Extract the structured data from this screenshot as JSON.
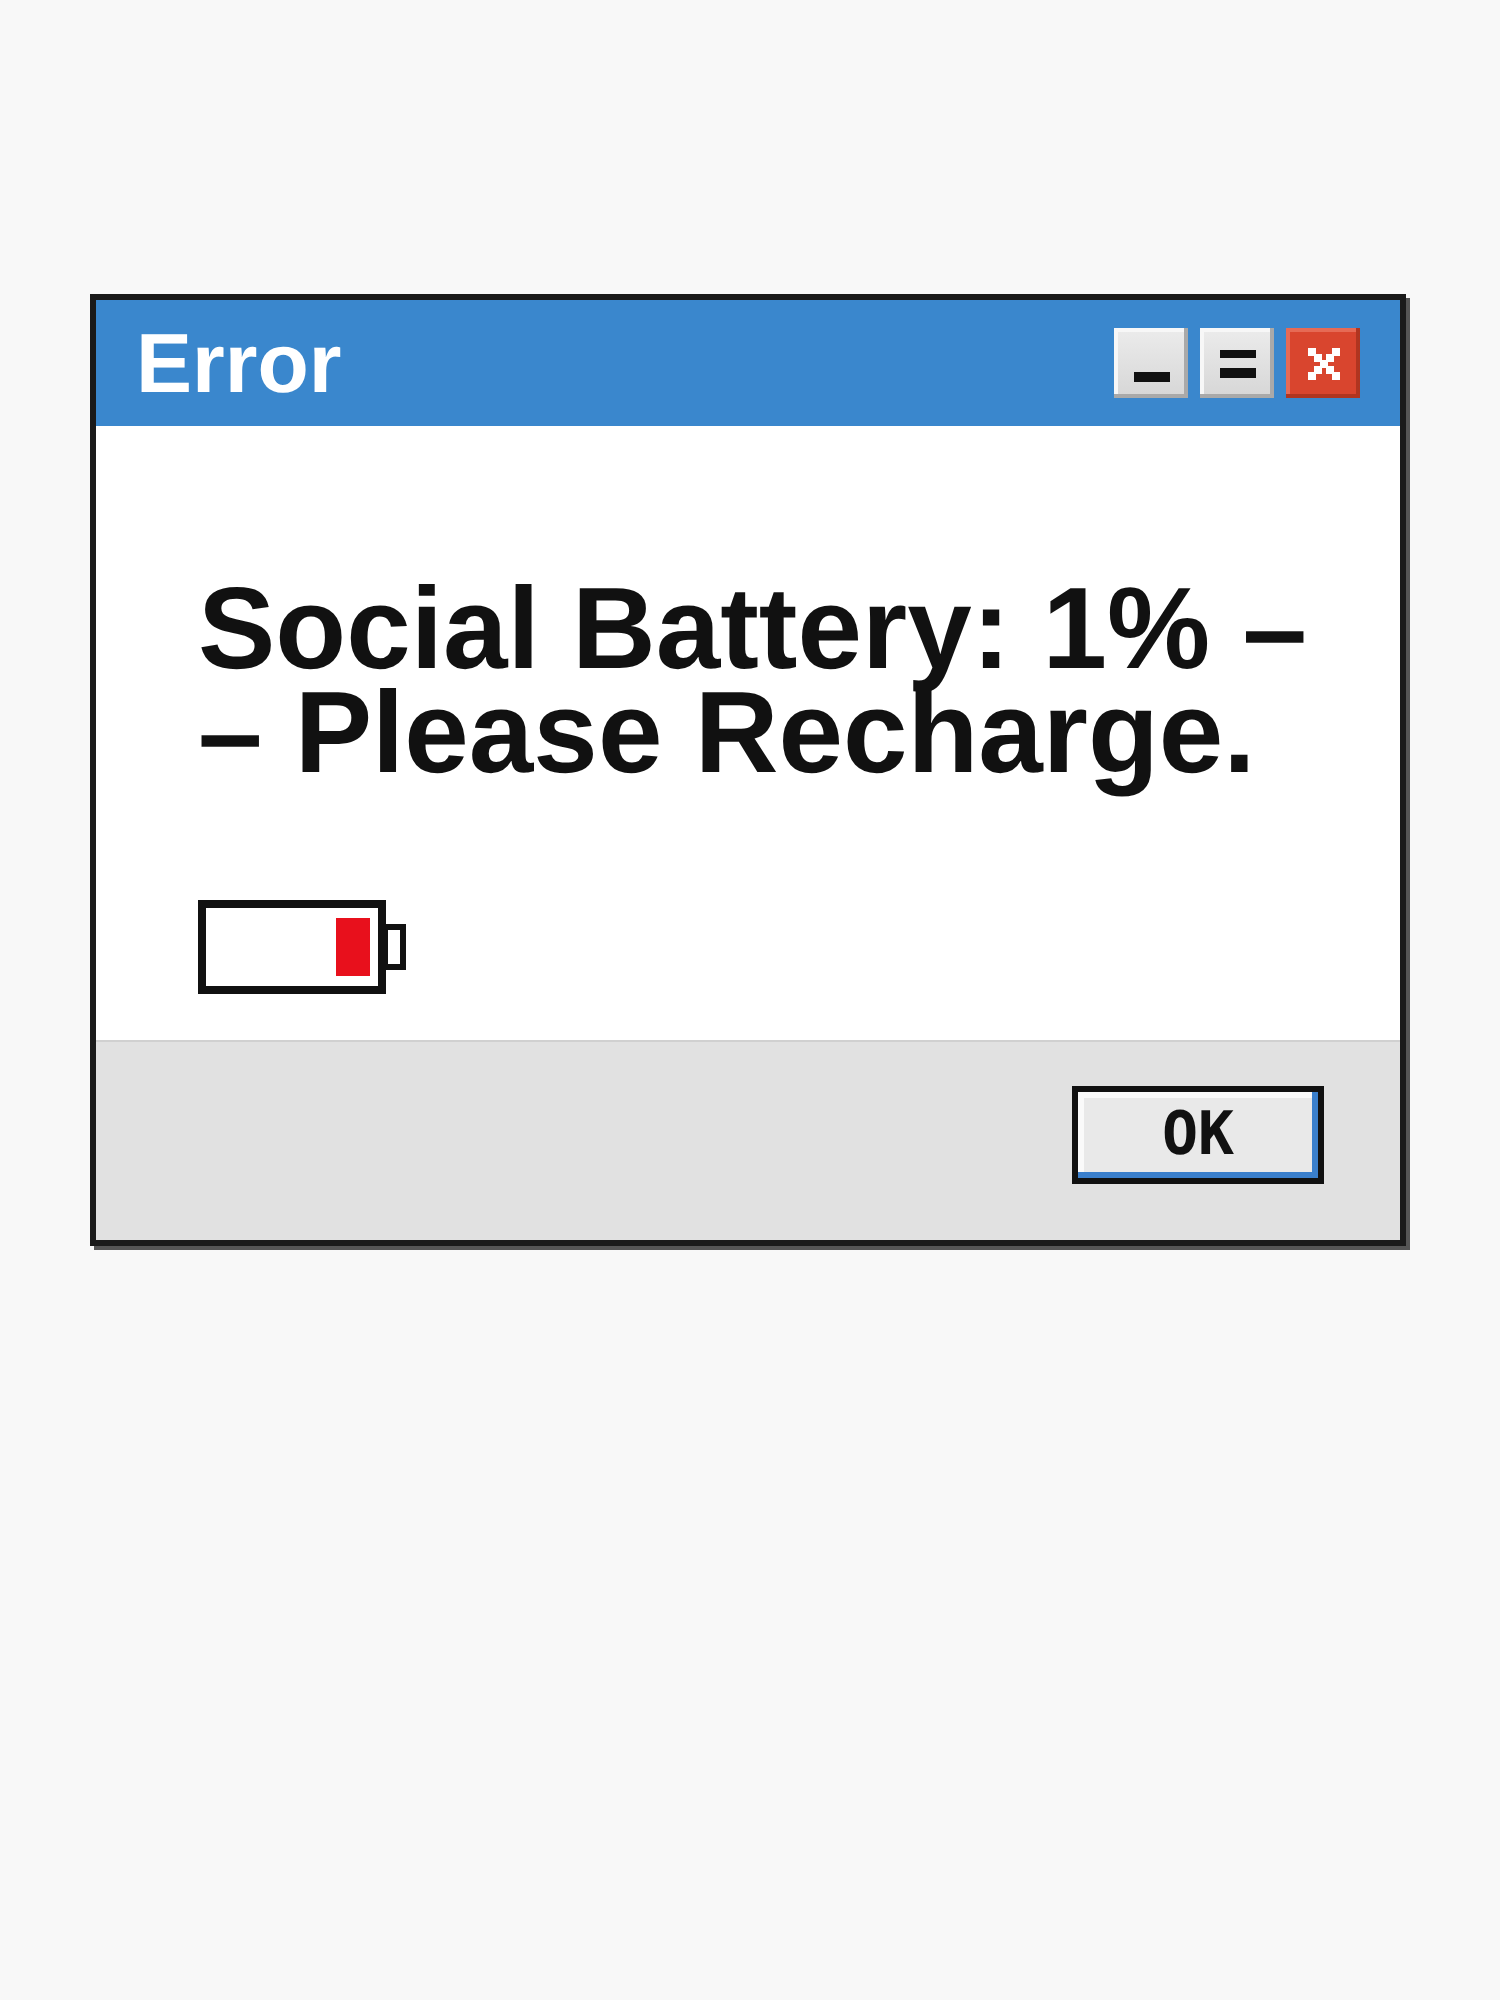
{
  "window": {
    "title": "Error",
    "controls": [
      {
        "kind": "minimize"
      },
      {
        "kind": "maximize"
      },
      {
        "kind": "close"
      }
    ]
  },
  "message": "Social Battery: 1% – – Please Recharge.",
  "buttons": [
    "OK"
  ]
}
